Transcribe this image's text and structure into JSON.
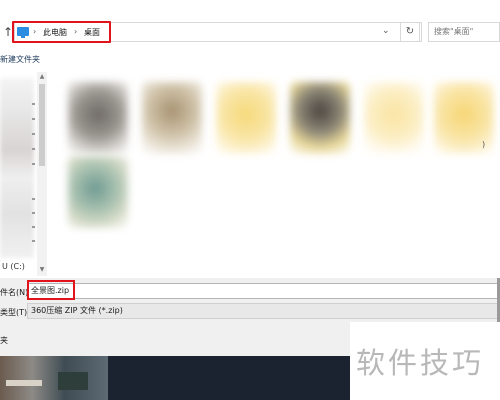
{
  "address": {
    "breadcrumbs": [
      "此电脑",
      "桌面"
    ],
    "separator": "›",
    "dropdown_glyph": "⌄",
    "refresh_glyph": "↻",
    "up_glyph": "↑",
    "search_placeholder": "搜索\"桌面\"",
    "icon": "pc-icon"
  },
  "toolbar": {
    "new_folder_label": "新建文件夹"
  },
  "nav": {
    "drive_label": "U (C:)",
    "scroll_up": "▲",
    "scroll_down": "▼"
  },
  "files": {
    "right_tick": ")"
  },
  "form": {
    "name_label": "件名(N):",
    "name_value": "全景图.zip",
    "type_label": "类型(T):",
    "type_value": "360压缩 ZIP 文件 (*.zip)",
    "hide_label": "夹"
  },
  "watermark": {
    "text": "软件技巧"
  },
  "colors": {
    "highlight": "#e0141a",
    "pc_icon": "#2b8ee0"
  }
}
